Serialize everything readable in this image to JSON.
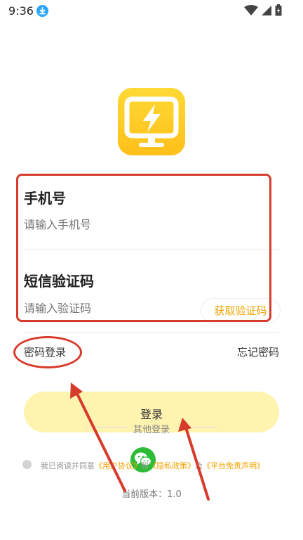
{
  "status_bar": {
    "time": "9:36"
  },
  "login_form": {
    "phone_label": "手机号",
    "phone_placeholder": "请输入手机号",
    "code_label": "短信验证码",
    "code_placeholder": "请输入验证码",
    "get_code_button": "获取验证码"
  },
  "password_login": "密码登录",
  "forgot_password": "忘记密码",
  "login_button": "登录",
  "other_login": "其他登录",
  "agreement": {
    "prefix": "我已阅读并同意",
    "user_agreement": "《用户协议》",
    "and1": "和",
    "privacy_policy": "《隐私政策》",
    "and2": "及",
    "disclaimer": "《平台免责声明》"
  },
  "version": "当前版本：1.0",
  "colors": {
    "accent": "#f3a300",
    "login_button_bg": "#fff3b0",
    "annotation_red": "#d63b2b",
    "wechat_green": "#2dbc36"
  }
}
